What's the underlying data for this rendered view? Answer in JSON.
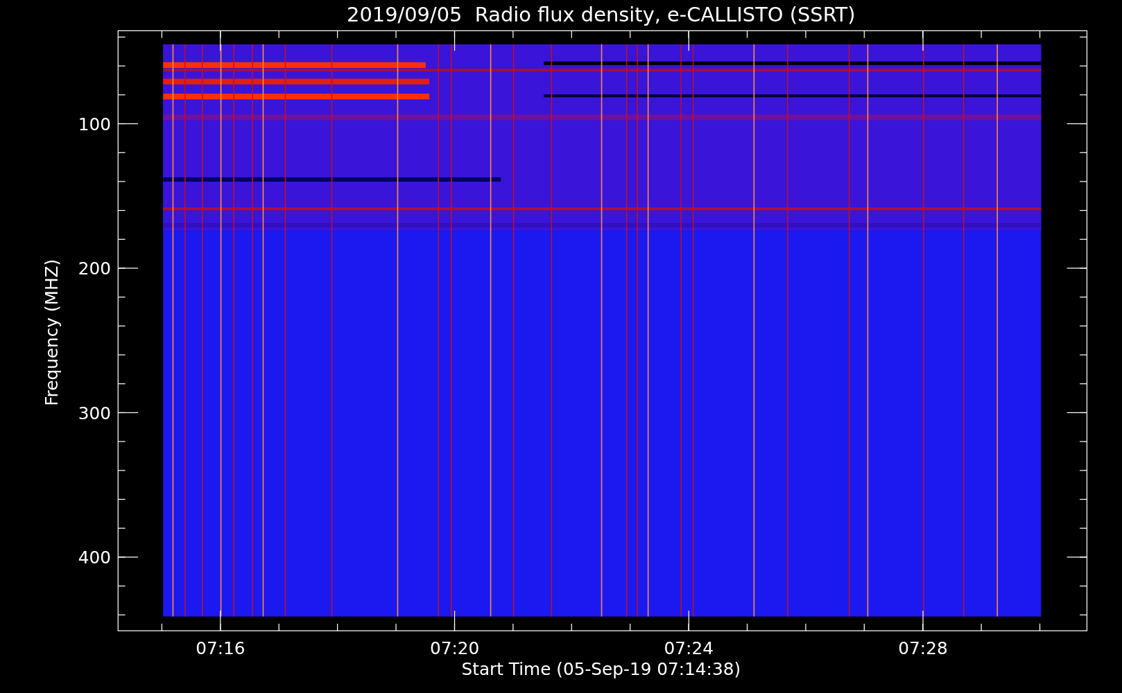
{
  "title": "2019/09/05  Radio flux density, e-CALLISTO (SSRT)",
  "y_axis": {
    "label": "Frequency (MHZ)",
    "ticks": [
      "100",
      "200",
      "300",
      "400"
    ]
  },
  "x_axis": {
    "label": "Start Time (05-Sep-19 07:14:38)",
    "ticks": [
      "07:16",
      "07:20",
      "07:24",
      "07:28"
    ]
  }
}
